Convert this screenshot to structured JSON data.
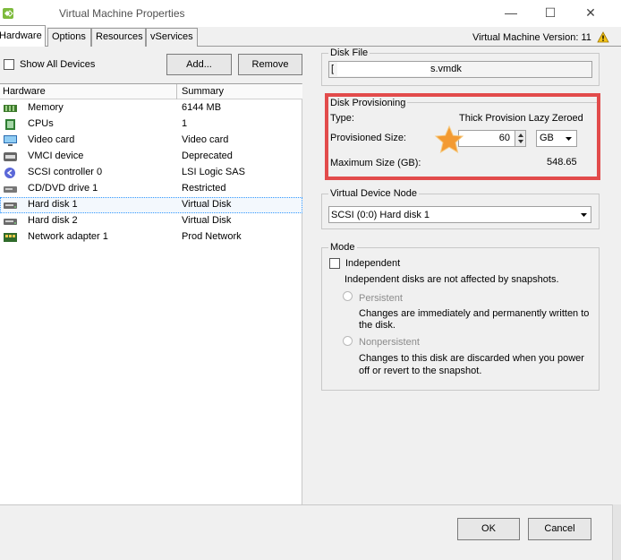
{
  "window": {
    "title": "Virtual Machine Properties",
    "minimize": "—",
    "maximize": "☐",
    "close": "✕"
  },
  "tabs": [
    {
      "label": "Hardware",
      "active": true
    },
    {
      "label": "Options"
    },
    {
      "label": "Resources"
    },
    {
      "label": "vServices"
    }
  ],
  "vm_version": "Virtual Machine Version: 11",
  "left": {
    "show_all_label": "Show All Devices",
    "add_button": "Add...",
    "remove_button": "Remove",
    "columns": [
      "Hardware",
      "Summary"
    ],
    "rows": [
      {
        "name": "Memory",
        "summary": "6144 MB",
        "icon": "memory-icon"
      },
      {
        "name": "CPUs",
        "summary": "1",
        "icon": "cpu-icon"
      },
      {
        "name": "Video card",
        "summary": "Video card",
        "icon": "monitor-icon"
      },
      {
        "name": "VMCI device",
        "summary": "Deprecated",
        "icon": "vmci-icon"
      },
      {
        "name": "SCSI controller 0",
        "summary": "LSI Logic SAS",
        "icon": "scsi-icon"
      },
      {
        "name": "CD/DVD drive 1",
        "summary": "Restricted",
        "icon": "cd-drive-icon"
      },
      {
        "name": "Hard disk 1",
        "summary": "Virtual Disk",
        "icon": "hard-disk-icon",
        "selected": true
      },
      {
        "name": "Hard disk 2",
        "summary": "Virtual Disk",
        "icon": "hard-disk-icon"
      },
      {
        "name": "Network adapter 1",
        "summary": "Prod Network",
        "icon": "network-adapter-icon"
      }
    ]
  },
  "disk_file": {
    "label": "Disk File",
    "value_start": "[",
    "value_end": "s.vmdk"
  },
  "provisioning": {
    "label": "Disk Provisioning",
    "type_label": "Type:",
    "type_value": "Thick Provision Lazy Zeroed",
    "size_label": "Provisioned Size:",
    "size_value": "60",
    "unit": "GB",
    "max_label": "Maximum Size (GB):",
    "max_value": "548.65"
  },
  "vdn": {
    "label": "Virtual Device Node",
    "value": "SCSI (0:0) Hard disk 1"
  },
  "mode": {
    "label": "Mode",
    "independent_label": "Independent",
    "independent_desc": "Independent disks are not affected by snapshots.",
    "persistent_label": "Persistent",
    "persistent_desc_1": "Changes are immediately and permanently written to",
    "persistent_desc_2": "the disk.",
    "nonpersistent_label": "Nonpersistent",
    "nonpersistent_desc_1": "Changes to this disk are discarded when you power",
    "nonpersistent_desc_2": "off or revert to the snapshot."
  },
  "footer": {
    "ok": "OK",
    "cancel": "Cancel"
  },
  "colors": {
    "highlight": "#e24b4b",
    "star": "#f39a32"
  }
}
